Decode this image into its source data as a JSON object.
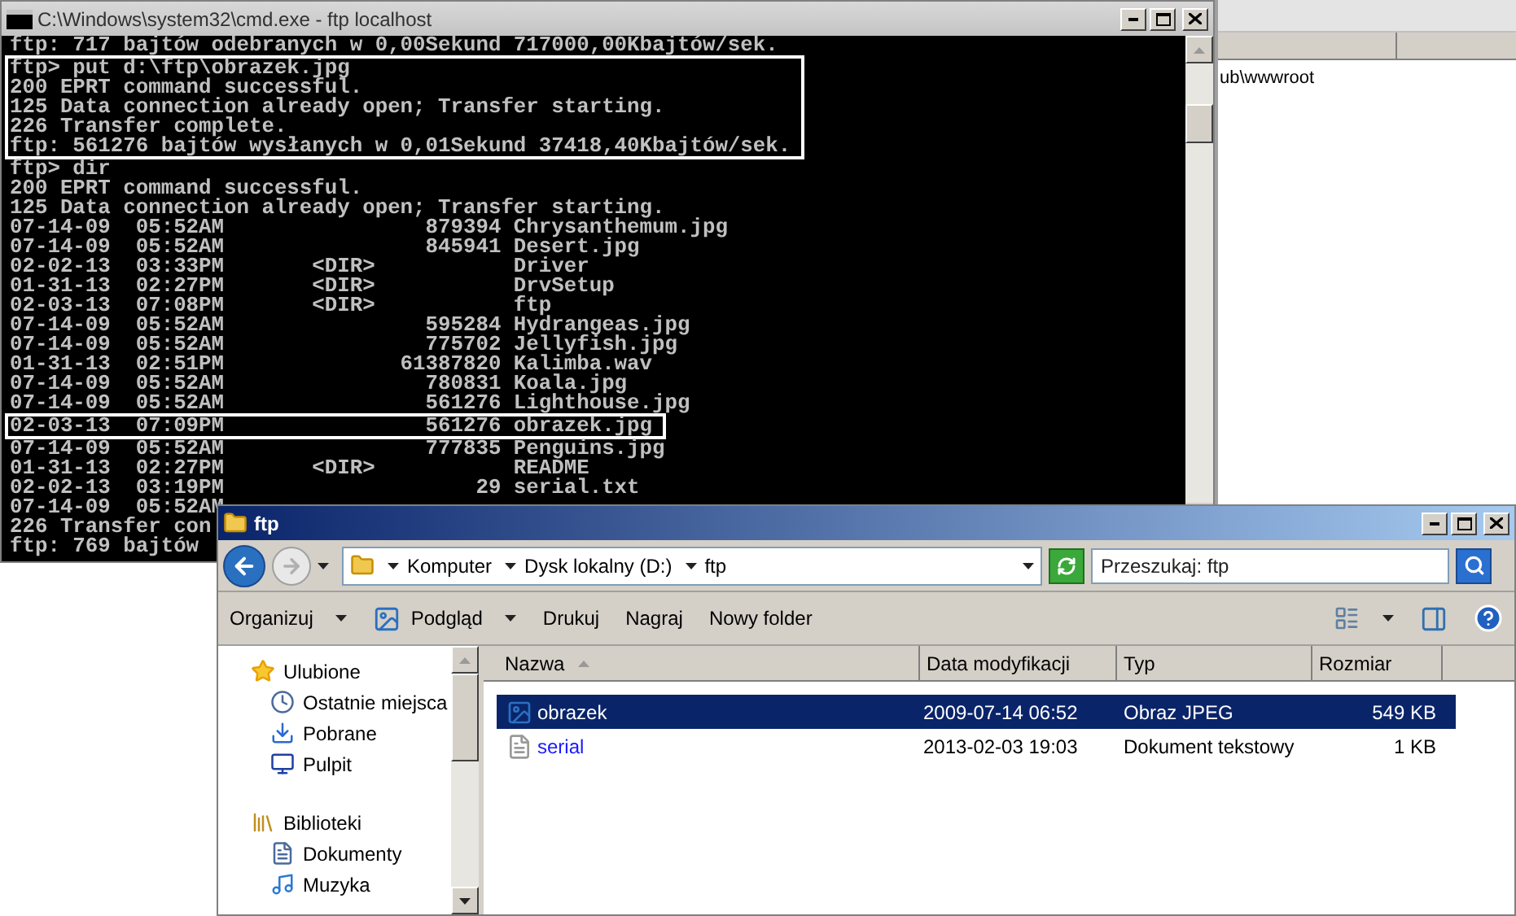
{
  "cmd": {
    "title": "C:\\Windows\\system32\\cmd.exe - ftp  localhost",
    "blocks": [
      {
        "highlighted": false,
        "lines": [
          "ftp: 717 bajtów odebranych w 0,00Sekund 717000,00Kbajtów/sek."
        ]
      },
      {
        "highlighted": true,
        "lines": [
          "ftp> put d:\\ftp\\obrazek.jpg",
          "200 EPRT command successful.",
          "125 Data connection already open; Transfer starting.",
          "226 Transfer complete.",
          "ftp: 561276 bajtów wysłanych w 0,01Sekund 37418,40Kbajtów/sek."
        ]
      },
      {
        "highlighted": false,
        "lines": [
          "ftp> dir",
          "200 EPRT command successful.",
          "125 Data connection already open; Transfer starting.",
          "07-14-09  05:52AM                879394 Chrysanthemum.jpg",
          "07-14-09  05:52AM                845941 Desert.jpg",
          "02-02-13  03:33PM       <DIR>           Driver",
          "01-31-13  02:27PM       <DIR>           DrvSetup",
          "02-03-13  07:08PM       <DIR>           ftp",
          "07-14-09  05:52AM                595284 Hydrangeas.jpg",
          "07-14-09  05:52AM                775702 Jellyfish.jpg",
          "01-31-13  02:51PM              61387820 Kalimba.wav",
          "07-14-09  05:52AM                780831 Koala.jpg",
          "07-14-09  05:52AM                561276 Lighthouse.jpg"
        ]
      },
      {
        "highlighted": true,
        "lines": [
          "02-03-13  07:09PM                561276 obrazek.jpg"
        ]
      },
      {
        "highlighted": false,
        "lines": [
          "07-14-09  05:52AM                777835 Penguins.jpg",
          "01-31-13  02:27PM       <DIR>           README",
          "02-02-13  03:19PM                    29 serial.txt",
          "07-14-09  05:52AM",
          "226 Transfer con",
          "ftp: 769 bajtów"
        ]
      }
    ]
  },
  "background_window": {
    "text": "ub\\wwwroot"
  },
  "explorer": {
    "title": "ftp",
    "breadcrumb": [
      "Komputer",
      "Dysk lokalny (D:)",
      "ftp"
    ],
    "search": {
      "placeholder": "Przeszukaj: ftp"
    },
    "toolbar": [
      {
        "label": "Organizuj",
        "kind": "menu"
      },
      {
        "label": "Podgląd",
        "kind": "preview"
      },
      {
        "label": "Drukuj",
        "kind": "plain"
      },
      {
        "label": "Nagraj",
        "kind": "plain"
      },
      {
        "label": "Nowy folder",
        "kind": "plain"
      }
    ],
    "nav": [
      {
        "label": "Ulubione",
        "kind": "favorites",
        "children": [
          {
            "label": "Ostatnie miejsca",
            "kind": "recent"
          },
          {
            "label": "Pobrane",
            "kind": "downloads"
          },
          {
            "label": "Pulpit",
            "kind": "desktop"
          }
        ]
      },
      {
        "label": "Biblioteki",
        "kind": "libraries",
        "children": [
          {
            "label": "Dokumenty",
            "kind": "documents"
          },
          {
            "label": "Muzyka",
            "kind": "music"
          }
        ]
      }
    ],
    "columns": [
      {
        "label": "Nazwa",
        "sorted": true
      },
      {
        "label": "Data modyfikacji",
        "sorted": false
      },
      {
        "label": "Typ",
        "sorted": false
      },
      {
        "label": "Rozmiar",
        "sorted": false
      }
    ],
    "files": [
      {
        "name": "obrazek",
        "kind": "image",
        "modified": "2009-07-14 06:52",
        "type": "Obraz JPEG",
        "size": "549 KB",
        "selected": true
      },
      {
        "name": "serial",
        "kind": "text",
        "modified": "2013-02-03 19:03",
        "type": "Dokument tekstowy",
        "size": "1 KB",
        "selected": false
      }
    ]
  }
}
